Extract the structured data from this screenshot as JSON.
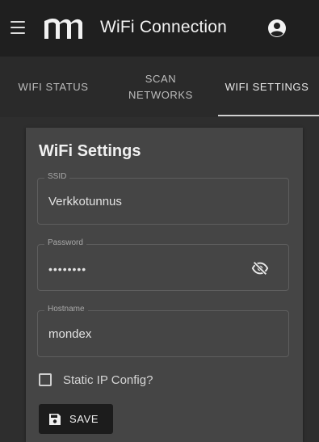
{
  "appbar": {
    "title": "WiFi Connection",
    "menu_icon": "hamburger-menu-icon",
    "logo_icon": "logo-icon",
    "account_icon": "account-circle-icon"
  },
  "tabs": [
    {
      "label": "WIFI STATUS",
      "active": false
    },
    {
      "label": "SCAN NETWORKS",
      "active": false
    },
    {
      "label": "WIFI SETTINGS",
      "active": true
    }
  ],
  "card": {
    "title": "WiFi Settings",
    "ssid": {
      "label": "SSID",
      "value": "Verkkotunnus"
    },
    "password": {
      "label": "Password",
      "value": "••••••••",
      "toggle_icon": "visibility-off-icon"
    },
    "hostname": {
      "label": "Hostname",
      "value": "mondex"
    },
    "static_ip": {
      "label": "Static IP Config?",
      "checked": false
    },
    "save_button": {
      "label": "SAVE",
      "icon": "save-icon"
    }
  },
  "colors": {
    "appbar_bg": "#1f1f1f",
    "page_bg": "#2e2e2e",
    "card_bg": "#454545",
    "button_bg": "#1c1c1c"
  }
}
